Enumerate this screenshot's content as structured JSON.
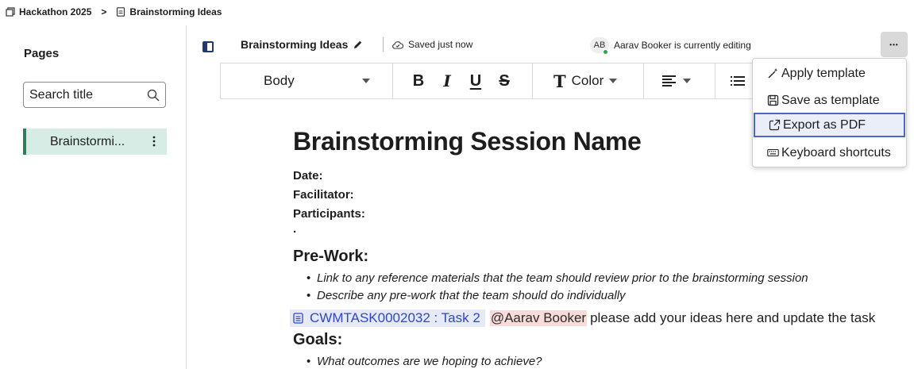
{
  "breadcrumb": {
    "workspace": "Hackathon 2025",
    "separator": ">",
    "page": "Brainstorming Ideas"
  },
  "sidebar": {
    "title": "Pages",
    "search_placeholder": "Search title",
    "items": [
      {
        "label": "Brainstormi..."
      }
    ]
  },
  "header": {
    "doc_title": "Brainstorming Ideas",
    "save_status": "Saved just now",
    "editor_initials": "AB",
    "editing_status": "Aarav Booker is currently editing",
    "more_label": "•••"
  },
  "toolbar": {
    "text_style": "Body",
    "bold": "B",
    "italic": "I",
    "underline": "U",
    "strike": "S",
    "color_glyph": "T",
    "color_label": "Color"
  },
  "menu": {
    "items": [
      {
        "label": "Apply template",
        "icon": "magic-wand-icon"
      },
      {
        "label": "Save as template",
        "icon": "save-icon"
      },
      {
        "label": "Export as PDF",
        "icon": "export-icon",
        "active": true
      },
      {
        "label": "Keyboard shortcuts",
        "icon": "keyboard-icon"
      }
    ]
  },
  "document": {
    "heading": "Brainstorming Session Name",
    "fields": [
      "Date:",
      "Facilitator:",
      "Participants:"
    ],
    "empty_bullet": "·",
    "sections": [
      {
        "heading": "Pre-Work:",
        "bullets": [
          "Link to any reference materials that the team should review prior to the brainstorming session",
          "Describe any pre-work that the team should do individually"
        ]
      },
      {
        "heading": "Goals:",
        "bullets": [
          "What outcomes are we hoping to achieve?"
        ]
      }
    ],
    "task": {
      "id": "CWMTASK0002032 :  Task 2",
      "mention": "@Aarav Booker",
      "text": "please add your ideas here and update the task"
    }
  },
  "colors": {
    "accent_green": "#2f7d5a",
    "selected_page_bg": "#d7ece4",
    "menu_focus_border": "#4a66c8",
    "task_link": "#2f47c6",
    "mention_bg": "#f8dcd9"
  }
}
